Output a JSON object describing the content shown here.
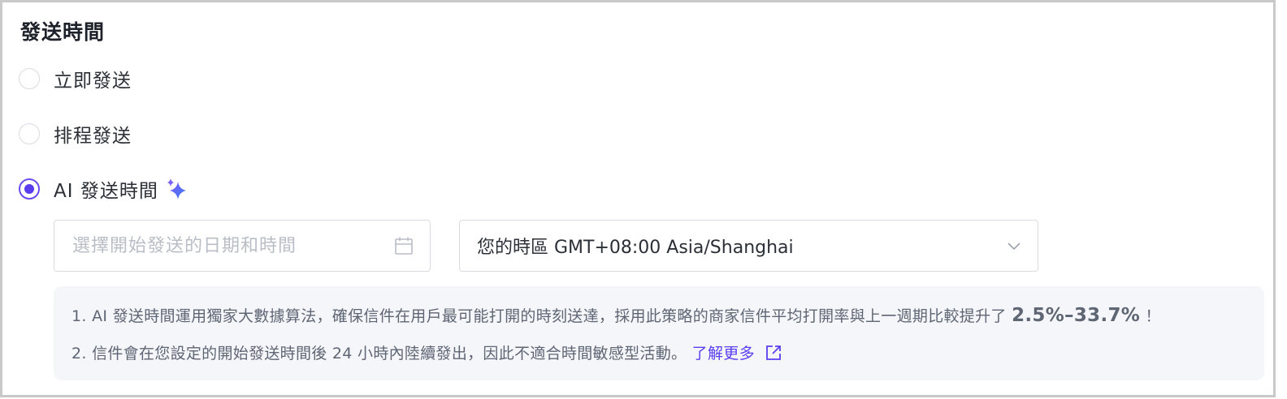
{
  "section": {
    "title": "發送時間"
  },
  "options": {
    "immediate": {
      "label": "立即發送",
      "checked": false
    },
    "scheduled": {
      "label": "排程發送",
      "checked": false
    },
    "ai": {
      "label": "AI 發送時間",
      "checked": true
    }
  },
  "date_input": {
    "placeholder": "選擇開始發送的日期和時間",
    "value": ""
  },
  "timezone": {
    "value": "您的時區 GMT+08:00 Asia/Shanghai"
  },
  "info": {
    "line1_prefix": "1. AI 發送時間運用獨家大數據算法，確保信件在用戶最可能打開的時刻送達，採用此策略的商家信件平均打開率與上一週期比較提升了",
    "line1_highlight": "2.5%–33.7%",
    "line1_suffix": "！",
    "line2_prefix": "2. 信件會在您設定的開始發送時間後 24 小時內陸續發出，因此不適合時間敏感型活動。",
    "learn_more": "了解更多"
  },
  "colors": {
    "accent": "#5b3df0",
    "info_bg": "#f5f6fa",
    "border": "#d9dbe0"
  },
  "icons": {
    "sparkle": "sparkle-icon",
    "calendar": "calendar-icon",
    "chevron": "chevron-down-icon",
    "external": "external-link-icon"
  }
}
